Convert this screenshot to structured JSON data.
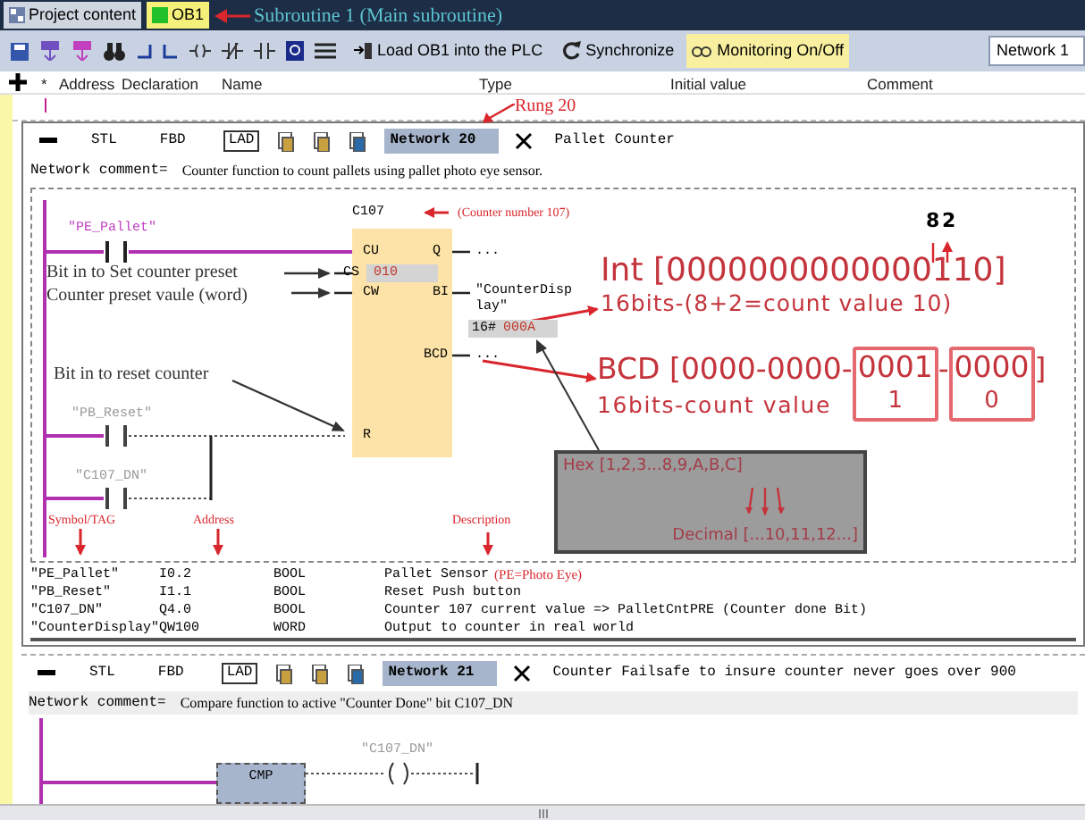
{
  "tabs": [
    {
      "label": "Project content",
      "selected": false
    },
    {
      "label": "OB1",
      "selected": true
    }
  ],
  "notes": {
    "subroutine": "Subroutine 1 (Main subroutine)",
    "rung": "Rung 20",
    "counter_number": "(Counter number 107)",
    "set_preset": "Bit in to Set counter preset",
    "preset_value": "Counter preset vaule (word)",
    "reset": "Bit in to reset counter",
    "symbol_tag": "Symbol/TAG",
    "address": "Address",
    "description": "Description",
    "bit_8": "8",
    "bit_2": "2",
    "int_line": "Int [0000000000000110]",
    "int_caption": "16bits-(8+2=count value 10)",
    "bcd_start": "BCD [0000-0000-",
    "bcd_nibble_1": "0001",
    "bcd_sep": "-",
    "bcd_nibble_0": "0000",
    "bcd_end": "]",
    "bcd_caption": "16bits-count value",
    "bcd_value_1": "1",
    "bcd_value_0": "0",
    "hex": "Hex [1,2,3...8,9,A,B,C]",
    "decimal": "Decimal [...10,11,12...]"
  },
  "toolbar": {
    "buttons": [
      {
        "label": "Load OB1 into the PLC",
        "selected": false
      },
      {
        "label": "Synchronize",
        "selected": false
      },
      {
        "label": "Monitoring On/Off",
        "selected": true
      }
    ],
    "network_field": "Network 1"
  },
  "declaration_columns": [
    "*",
    "Address",
    "Declaration",
    "Name",
    "Type",
    "Initial value",
    "Comment"
  ],
  "networks": [
    {
      "views": [
        {
          "label": "STL",
          "selected": false
        },
        {
          "label": "FBD",
          "selected": false
        },
        {
          "label": "LAD",
          "selected": true
        }
      ],
      "title": "Network 20",
      "name": "Pallet Counter",
      "comment_label": "Network comment=",
      "comment": "Counter function to count pallets using pallet photo eye sensor."
    },
    {
      "views": [
        {
          "label": "STL",
          "selected": false
        },
        {
          "label": "FBD",
          "selected": false
        },
        {
          "label": "LAD",
          "selected": true
        }
      ],
      "title": "Network 21",
      "name": "Counter Failsafe to insure counter never goes over 900",
      "comment_label": "Network comment=",
      "comment": "Compare function to active \"Counter Done\" bit C107_DN"
    }
  ],
  "counter": {
    "name": "C107",
    "inputs": [
      "CU",
      "CS",
      "CW",
      "R"
    ],
    "outputs": [
      "Q",
      "BI",
      "BCD"
    ],
    "preset": "010",
    "q_out": "...",
    "bi_out": "\"CounterDisplay\"",
    "bi_value_prefix": "16#",
    "bi_value": "000A",
    "bcd_out": "..."
  },
  "contacts": [
    {
      "tag": "\"PE_Pallet\"",
      "active": true
    },
    {
      "tag": "\"PB_Reset\"",
      "active": false
    },
    {
      "tag": "\"C107_DN\"",
      "active": false
    }
  ],
  "symbols": [
    {
      "symbol": "\"PE_Pallet\"",
      "address": "I0.2",
      "type": "BOOL",
      "description": "Pallet Sensor",
      "note": "(PE=Photo Eye)"
    },
    {
      "symbol": "\"PB_Reset\"",
      "address": "I1.1",
      "type": "BOOL",
      "description": "Reset Push button"
    },
    {
      "symbol": "\"C107_DN\"",
      "address": "Q4.0",
      "type": "BOOL",
      "description": "Counter 107 current value => PalletCntPRE (Counter done Bit)"
    },
    {
      "symbol": "\"CounterDisplay\"",
      "address": "QW100",
      "type": "WORD",
      "description": "Output to counter in real world"
    }
  ],
  "compare": {
    "label": "CMP",
    "coil": "\"C107_DN\""
  }
}
